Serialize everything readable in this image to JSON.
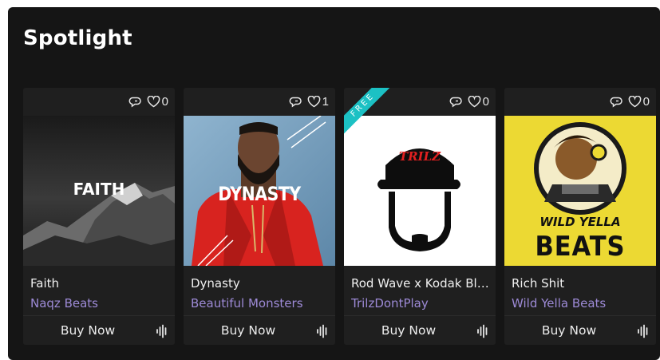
{
  "section": {
    "title": "Spotlight"
  },
  "cards": [
    {
      "name": "Faith",
      "producer": "Naqz Beats",
      "likes": "0",
      "buy_label": "Buy Now",
      "cover_text": "FAITH",
      "badge": ""
    },
    {
      "name": "Dynasty",
      "producer": "Beautiful Monsters",
      "likes": "1",
      "buy_label": "Buy Now",
      "cover_text": "DYNASTY",
      "badge": ""
    },
    {
      "name": "Rod Wave x Kodak Bla...",
      "producer": "TrilzDontPlay",
      "likes": "0",
      "buy_label": "Buy Now",
      "cover_text": "TRILZ",
      "badge": "FREE"
    },
    {
      "name": "Rich Shit",
      "producer": "Wild Yella Beats",
      "likes": "0",
      "buy_label": "Buy Now",
      "cover_text": "WILD YELLA",
      "cover_text_2": "BEATS",
      "badge": ""
    }
  ],
  "icons": {
    "comment": "comment-icon",
    "like": "heart-icon",
    "waveform": "waveform-icon"
  },
  "colors": {
    "panel_bg": "#151515",
    "card_bg": "#1f1f1f",
    "producer_link": "#9d8ad6",
    "free_badge": "#1cc1c4",
    "yella_bg": "#ecd933"
  }
}
